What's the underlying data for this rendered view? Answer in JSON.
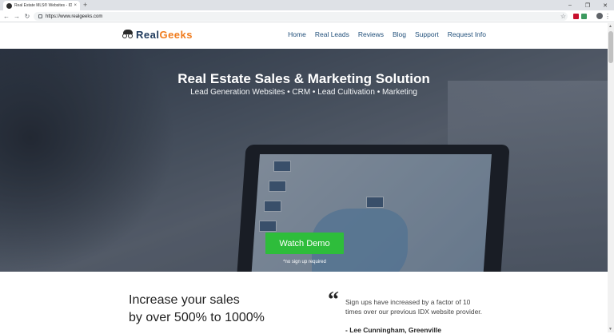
{
  "browser": {
    "tab_title": "Real Estate MLS® Websites - IDX",
    "tab_close": "×",
    "new_tab": "+",
    "url": "https://www.realgeeks.com",
    "window_controls": [
      "–",
      "❐",
      "✕"
    ]
  },
  "site": {
    "logo_real": "Real",
    "logo_geeks": "Geeks",
    "nav": [
      "Home",
      "Real Leads",
      "Reviews",
      "Blog",
      "Support",
      "Request Info"
    ]
  },
  "hero": {
    "title": "Real Estate Sales & Marketing Solution",
    "subtitle": "Lead Generation Websites • CRM • Lead Cultivation • Marketing",
    "cta": "Watch Demo",
    "note": "*no sign up required"
  },
  "content": {
    "headline_line1": "Increase your sales",
    "headline_line2": "by over 500% to 1000%",
    "quote_mark": "“",
    "quote": "Sign ups have increased by a factor of 10 times over our previous IDX website provider.",
    "quote_author": "- Lee Cunningham, Greenville"
  },
  "colors": {
    "accent_green": "#2ebd3b",
    "brand_navy": "#1f3a5c",
    "brand_orange": "#f07c1e"
  }
}
